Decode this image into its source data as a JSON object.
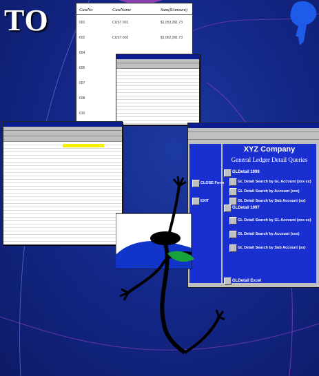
{
  "slide": {
    "title": "TO"
  },
  "report": {
    "columns": [
      "CustNo",
      "CustName",
      "Sum($Amount)"
    ],
    "rows": [
      {
        "no": "001",
        "name": "CUST 001",
        "amt": "$1,053,261.73"
      },
      {
        "no": "002",
        "name": "CUST 002",
        "amt": "$1,062,261.73"
      },
      {
        "no": "004",
        "name": "",
        "amt": ""
      },
      {
        "no": "005",
        "name": "",
        "amt": ""
      },
      {
        "no": "007",
        "name": "",
        "amt": ""
      },
      {
        "no": "008",
        "name": "",
        "amt": ""
      },
      {
        "no": "010",
        "name": "",
        "amt": ""
      }
    ]
  },
  "app": {
    "company": "XYZ Company",
    "subtitle": "General Ledger Detail Queries",
    "left_buttons": [
      "CLOSE Form",
      "EXIT"
    ],
    "sections": [
      {
        "title": "GLDetail 1998",
        "items": [
          "GL Detail Search by GL Account (xxx-xx)",
          "GL Detail Search by Account (xxx)",
          "GL Detail Search by Sub Account (xx)"
        ]
      },
      {
        "title": "GLDetail 1997",
        "items": [
          "GL Detail Search by GL Account (xxx-xx)",
          "GL Detail Search by Account (xxx)",
          "GL Detail Search by Sub Account (xx)"
        ]
      },
      {
        "title": "GLDetail Excel",
        "items": []
      }
    ]
  },
  "colors": {
    "background": "#14288a",
    "accent": "#8b3fb1",
    "app_panel": "#1a2fd0"
  }
}
